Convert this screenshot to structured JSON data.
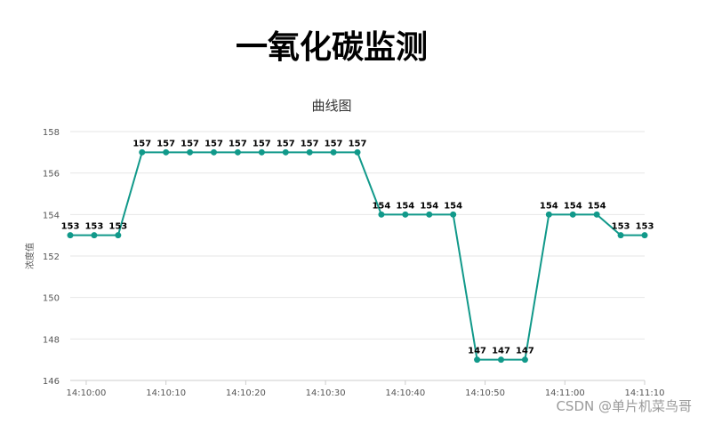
{
  "page": {
    "title": "一氧化碳监测",
    "watermark": "CSDN @单片机菜鸟哥"
  },
  "colors": {
    "line": "#11998a",
    "grid": "#e6e6e6",
    "axis_text": "#555555",
    "label_text": "#000000"
  },
  "chart_data": {
    "type": "line",
    "title": "曲线图",
    "ylabel": "浓度值",
    "xlabel": "",
    "ylim": [
      146,
      158
    ],
    "yticks": [
      146,
      148,
      150,
      152,
      154,
      156,
      158
    ],
    "xlim": [
      "14:09:58",
      "14:11:10"
    ],
    "xticks": [
      "14:10:00",
      "14:10:10",
      "14:10:20",
      "14:10:30",
      "14:10:40",
      "14:10:50",
      "14:11:00",
      "14:11:10"
    ],
    "grid": true,
    "data_labels": true,
    "series": [
      {
        "x": [
          "14:09:58",
          "14:10:01",
          "14:10:04",
          "14:10:07",
          "14:10:10",
          "14:10:13",
          "14:10:16",
          "14:10:19",
          "14:10:22",
          "14:10:25",
          "14:10:28",
          "14:10:31",
          "14:10:34",
          "14:10:37",
          "14:10:40",
          "14:10:43",
          "14:10:46",
          "14:10:49",
          "14:10:52",
          "14:10:55",
          "14:10:58",
          "14:11:01",
          "14:11:04",
          "14:11:07",
          "14:11:10"
        ],
        "values": [
          153,
          153,
          153,
          157,
          157,
          157,
          157,
          157,
          157,
          157,
          157,
          157,
          157,
          154,
          154,
          154,
          154,
          147,
          147,
          147,
          154,
          154,
          154,
          153,
          153
        ]
      }
    ]
  }
}
